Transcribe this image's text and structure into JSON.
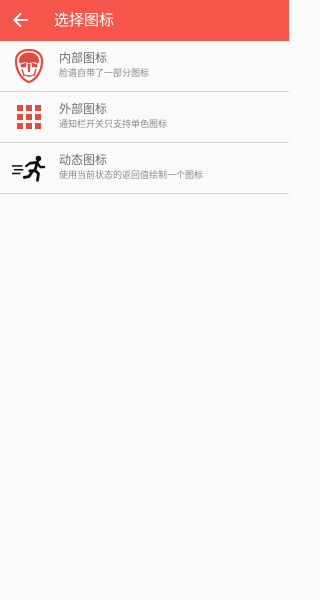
{
  "appbar": {
    "title": "选择图标",
    "back_icon": "arrow-back-icon",
    "background": "#f4564b"
  },
  "items": [
    {
      "label": "内部图标",
      "description": "脸谱自带了一部分图标",
      "icon": "opera-mask-icon",
      "icon_color": "#e64a3f"
    },
    {
      "label": "外部图标",
      "description": "通知栏开关只支持单色图标",
      "icon": "grid-apps-icon",
      "icon_color": "#e64a3f"
    },
    {
      "label": "动态图标",
      "description": "使用当前状态的返回值绘制一个图标",
      "icon": "running-man-icon",
      "icon_color": "#111111"
    }
  ]
}
